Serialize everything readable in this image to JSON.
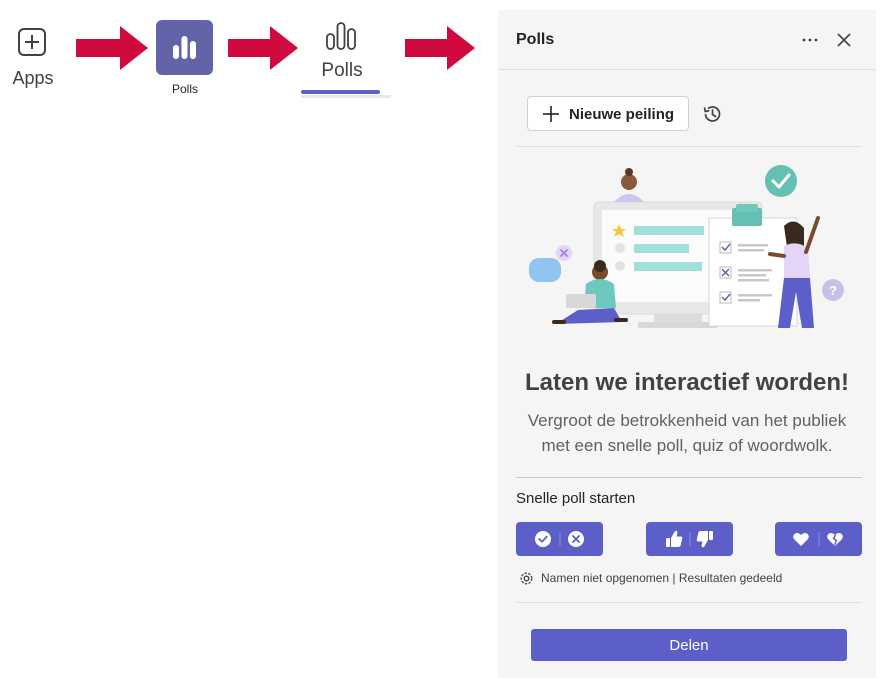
{
  "left_flow": {
    "apps_label": "Apps",
    "polls_tile_label": "Polls",
    "polls_tab_label": "Polls",
    "arrow_color": "#d0093f",
    "tile_color": "#6264a7"
  },
  "panel": {
    "title": "Polls",
    "more_icon": "more-horizontal-icon",
    "close_icon": "close-icon",
    "new_poll_label": "Nieuwe peiling",
    "history_icon": "history-icon",
    "heading": "Laten we interactief worden!",
    "subtext_line1": "Vergroot de betrokkenheid van het publiek",
    "subtext_line2": "met een snelle poll, quiz of woordwolk.",
    "quick_poll": {
      "title": "Snelle poll starten",
      "buttons": [
        {
          "name": "check-cross",
          "icons": [
            "check-circle-icon",
            "cross-circle-icon"
          ]
        },
        {
          "name": "thumbs",
          "icons": [
            "thumbs-up-icon",
            "thumbs-down-icon"
          ]
        },
        {
          "name": "hearts",
          "icons": [
            "heart-icon",
            "broken-heart-icon"
          ]
        }
      ]
    },
    "settings_text": "Namen niet opgenomen | Resultaten gedeeld",
    "share_label": "Delen",
    "accent_color": "#5b5fc7"
  }
}
